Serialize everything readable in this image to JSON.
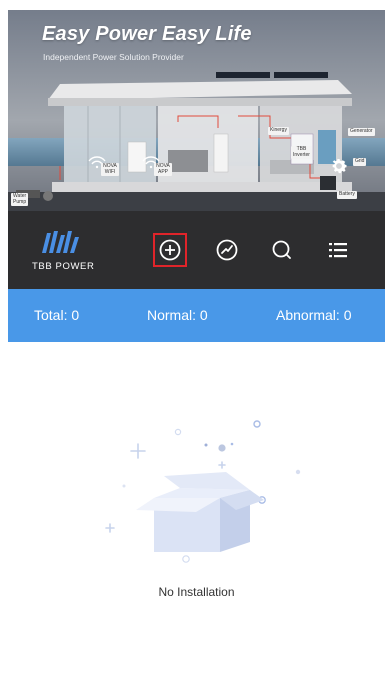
{
  "banner": {
    "title": "Easy Power Easy Life",
    "subtitle": "Independent Power Solution Provider",
    "labels": {
      "nova_wifi": "NOVA\nWIFI",
      "nova_app": "NOVA\nAPP",
      "kinergy": "Kinergy",
      "tbb_inverter": "TBB\nInverter",
      "generator": "Generator",
      "grid": "Grid",
      "battery": "Battery",
      "water_pump": "Water\nPump"
    }
  },
  "brand": {
    "logo_text": "TBB POWER",
    "accent": "#4998e8",
    "highlight": "#e0242a"
  },
  "nav": {
    "items": [
      {
        "icon": "add-circle-icon"
      },
      {
        "icon": "dashboard-gauge-icon"
      },
      {
        "icon": "search-icon"
      },
      {
        "icon": "list-menu-icon"
      }
    ]
  },
  "stats": {
    "total": "Total: 0",
    "normal": "Normal: 0",
    "abnormal": "Abnormal: 0"
  },
  "empty_state": {
    "message": "No Installation"
  }
}
